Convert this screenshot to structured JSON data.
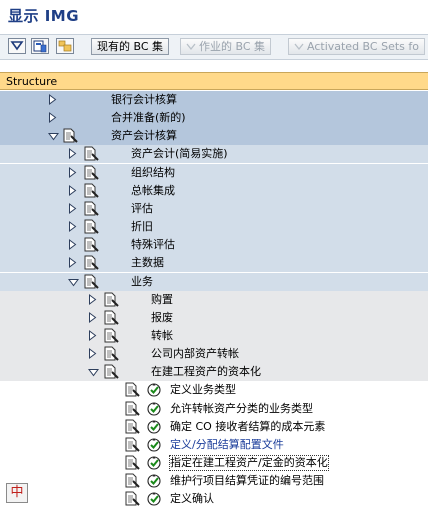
{
  "title": "显示 IMG",
  "toolbar": {
    "icons": [
      "expand-node-icon",
      "documentation-icon",
      "tree-options-icon"
    ],
    "buttons": [
      {
        "label": "现有的 BC 集",
        "enabled": true
      },
      {
        "label": "作业的 BC 集",
        "enabled": false
      },
      {
        "label": "Activated BC Sets fo",
        "enabled": false
      }
    ]
  },
  "structure_header": "Structure",
  "tree": [
    {
      "label": "银行会计核算",
      "level": 1,
      "expanded": false,
      "doc": false
    },
    {
      "label": "合并准备(新的)",
      "level": 1,
      "expanded": false,
      "doc": false
    },
    {
      "label": "资产会计核算",
      "level": 1,
      "expanded": true,
      "doc": true
    },
    {
      "label": "资产会计(简易实施)",
      "level": 2,
      "expanded": false,
      "doc": true
    },
    {
      "label": "组织结构",
      "level": 2,
      "expanded": false,
      "doc": true
    },
    {
      "label": "总帐集成",
      "level": 2,
      "expanded": false,
      "doc": true
    },
    {
      "label": "评估",
      "level": 2,
      "expanded": false,
      "doc": true
    },
    {
      "label": "折旧",
      "level": 2,
      "expanded": false,
      "doc": true
    },
    {
      "label": "特殊评估",
      "level": 2,
      "expanded": false,
      "doc": true
    },
    {
      "label": "主数据",
      "level": 2,
      "expanded": false,
      "doc": true
    },
    {
      "label": "业务",
      "level": 2,
      "expanded": true,
      "doc": true
    },
    {
      "label": "购置",
      "level": 3,
      "expanded": false,
      "doc": true
    },
    {
      "label": "报废",
      "level": 3,
      "expanded": false,
      "doc": true
    },
    {
      "label": "转帐",
      "level": 3,
      "expanded": false,
      "doc": true
    },
    {
      "label": "公司内部资产转帐",
      "level": 3,
      "expanded": false,
      "doc": true
    },
    {
      "label": "在建工程资产的资本化",
      "level": 3,
      "expanded": true,
      "doc": true
    },
    {
      "label": "定义业务类型",
      "level": 4,
      "activity": true
    },
    {
      "label": "允许转帐资产分类的业务类型",
      "level": 4,
      "activity": true
    },
    {
      "label": "确定 CO 接收者结算的成本元素",
      "level": 4,
      "activity": true
    },
    {
      "label": "定义/分配结算配置文件",
      "level": 4,
      "activity": true,
      "link": true
    },
    {
      "label": "指定在建工程资产/定金的资本化",
      "level": 4,
      "activity": true,
      "selected": true
    },
    {
      "label": "维护行项目结算凭证的编号范围",
      "level": 4,
      "activity": true
    },
    {
      "label": "定义确认",
      "level": 4,
      "activity": true
    }
  ],
  "ime_indicator": "中"
}
